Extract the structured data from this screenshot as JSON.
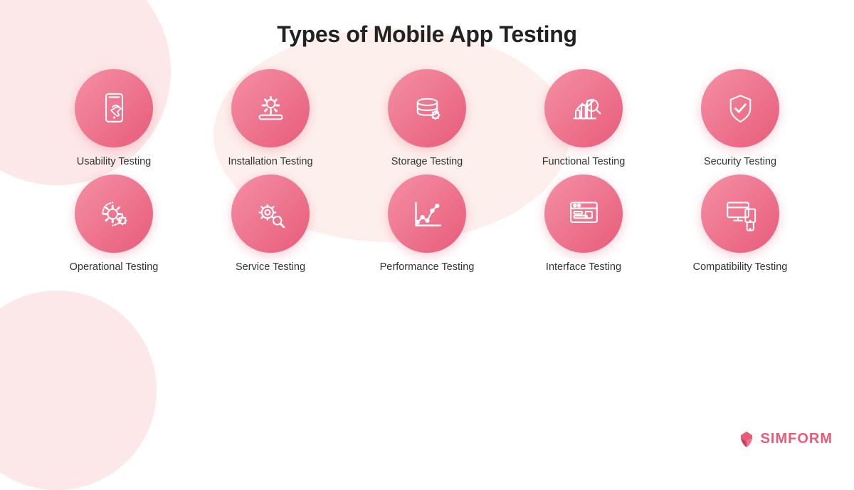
{
  "page": {
    "title": "Types of Mobile App Testing",
    "background_color": "#ffffff"
  },
  "logo": {
    "text": "SIMFORM",
    "brand_color": "#e85c7a"
  },
  "rows": [
    {
      "id": "row1",
      "items": [
        {
          "id": "usability",
          "label": "Usability Testing",
          "icon": "smartphone"
        },
        {
          "id": "installation",
          "label": "Installation Testing",
          "icon": "installation"
        },
        {
          "id": "storage",
          "label": "Storage Testing",
          "icon": "storage"
        },
        {
          "id": "functional",
          "label": "Functional Testing",
          "icon": "functional"
        },
        {
          "id": "security",
          "label": "Security Testing",
          "icon": "security"
        }
      ]
    },
    {
      "id": "row2",
      "items": [
        {
          "id": "operational",
          "label": "Operational Testing",
          "icon": "operational"
        },
        {
          "id": "service",
          "label": "Service Testing",
          "icon": "service"
        },
        {
          "id": "performance",
          "label": "Performance Testing",
          "icon": "performance"
        },
        {
          "id": "interface",
          "label": "Interface Testing",
          "icon": "interface"
        },
        {
          "id": "compatibility",
          "label": "Compatibility Testing",
          "icon": "compatibility"
        }
      ]
    }
  ]
}
